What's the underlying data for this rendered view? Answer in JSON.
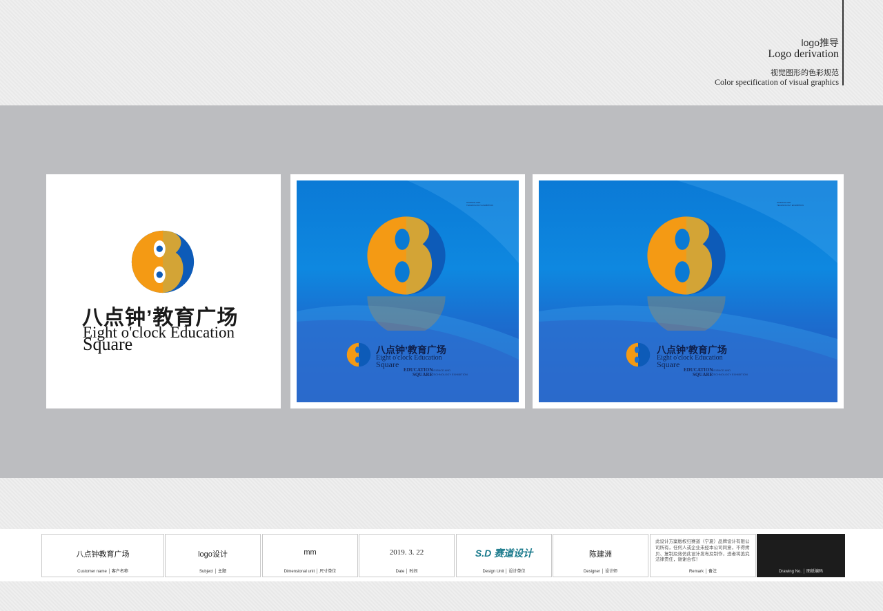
{
  "header": {
    "title_cn": "logo推导",
    "title_en": "Logo derivation",
    "subtitle_cn": "视觉图形的色彩规范",
    "subtitle_en": "Color specification of visual graphics"
  },
  "brand": {
    "name_cn": "八点钟’教育广场",
    "name_en_line1": "Eight o'clock Education",
    "name_en_line2": "Square",
    "tag_line1": "EDUCATION",
    "tag_line2": "SQUARE",
    "tag_small1": "SCIENCE AND",
    "tag_small2": "TECHNOLOGY EXHIBITION",
    "corner_line1": "SCIENCE AND",
    "corner_line2": "TECHNOLOGY EXHIBITION"
  },
  "colors": {
    "logo_orange": "#f49a14",
    "logo_blue": "#0d5bb8",
    "background_blue": "#0e88e0"
  },
  "footer": {
    "customer": {
      "value": "八点钟教育广场",
      "label": "Customer name │ 客户名称"
    },
    "subject": {
      "value": "logo设计",
      "label": "Subject │ 主题"
    },
    "unit": {
      "value": "mm",
      "label": "Dimensional unit │ 尺寸单位"
    },
    "date": {
      "value": "2019. 3. 22",
      "label": "Date │ 时间"
    },
    "design_unit": {
      "logo_text": "S.D 赛道设计",
      "label": "Design Unit │ 设计单位"
    },
    "designer": {
      "value": "陈建洲",
      "label": "Designer │ 设计师"
    },
    "remark": {
      "text": "此设计方案版权归赛道（宁夏）品牌设计有限公司所有，任何人或企业未经本公司同意，不得拷贝、复制及效仿此设计发布及制作，违者将追究法律责任，谢谢合作！",
      "label": "Remark │ 备注"
    },
    "drawing_no": {
      "label": "Drawing No. │ 图纸编码"
    }
  }
}
